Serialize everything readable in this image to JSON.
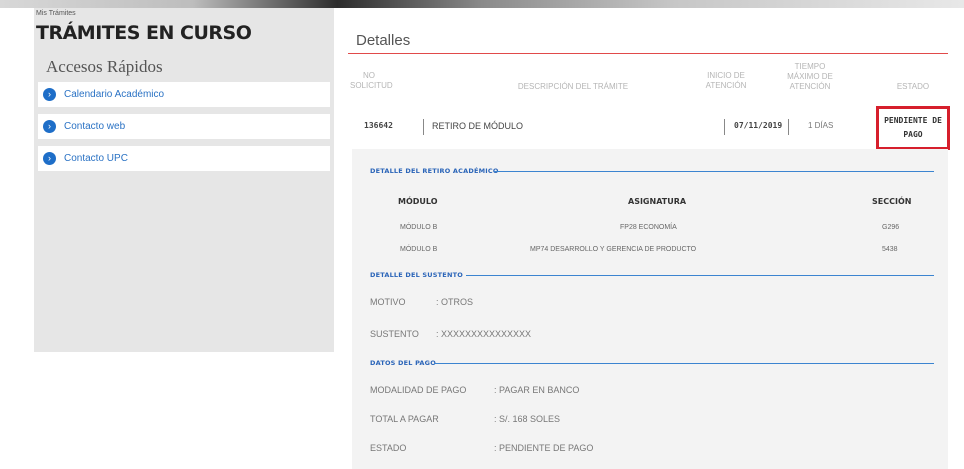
{
  "breadcrumb": "Mis Trámites",
  "page_title": "TRÁMITES EN CURSO",
  "quick_access": {
    "title": "Accesos Rápidos",
    "items": [
      {
        "label": "Calendario Académico",
        "icon": "chevron-right-icon"
      },
      {
        "label": "Contacto web",
        "icon": "chevron-right-icon"
      },
      {
        "label": "Contacto UPC",
        "icon": "chevron-right-icon"
      }
    ]
  },
  "detail": {
    "title": "Detalles",
    "columns": {
      "no_solicitud": [
        "NO",
        "SOLICITUD"
      ],
      "descripcion": "DESCRIPCIÓN DEL TRÁMITE",
      "inicio": [
        "INICIO DE",
        "ATENCIÓN"
      ],
      "tiempo": [
        "TIEMPO",
        "MÁXIMO DE",
        "ATENCIÓN"
      ],
      "estado": "ESTADO"
    },
    "row": {
      "no_solicitud": "136642",
      "descripcion": "RETIRO DE MÓDULO",
      "inicio": "07/11/2019",
      "tiempo": "1 DÍAS",
      "estado": [
        "PENDIENTE DE",
        "PAGO"
      ]
    }
  },
  "retiro": {
    "heading": "DETALLE DEL RETIRO ACADÉMICO",
    "headers": {
      "modulo": "MÓDULO",
      "asignatura": "ASIGNATURA",
      "seccion": "SECCIÓN"
    },
    "rows": [
      {
        "modulo": "MÓDULO B",
        "asignatura": "FP28 ECONOMÍA",
        "seccion": "G296"
      },
      {
        "modulo": "MÓDULO B",
        "asignatura": "MP74 DESARROLLO Y GERENCIA DE PRODUCTO",
        "seccion": "5438"
      }
    ]
  },
  "sustento": {
    "heading": "DETALLE DEL SUSTENTO",
    "motivo_label": "MOTIVO",
    "motivo_value": ": OTROS",
    "sustento_label": "SUSTENTO",
    "sustento_value": ": XXXXXXXXXXXXXXX"
  },
  "pago": {
    "heading": "DATOS DEL PAGO",
    "modalidad_label": "MODALIDAD DE PAGO",
    "modalidad_value": ": PAGAR EN BANCO",
    "total_label": "TOTAL A PAGAR",
    "total_value": ": S/. 168 SOLES",
    "estado_label": "ESTADO",
    "estado_value": ": PENDIENTE DE PAGO"
  },
  "colors": {
    "accent": "#2a72c4",
    "alert": "#d61f2c",
    "divider": "#e14a4a"
  }
}
